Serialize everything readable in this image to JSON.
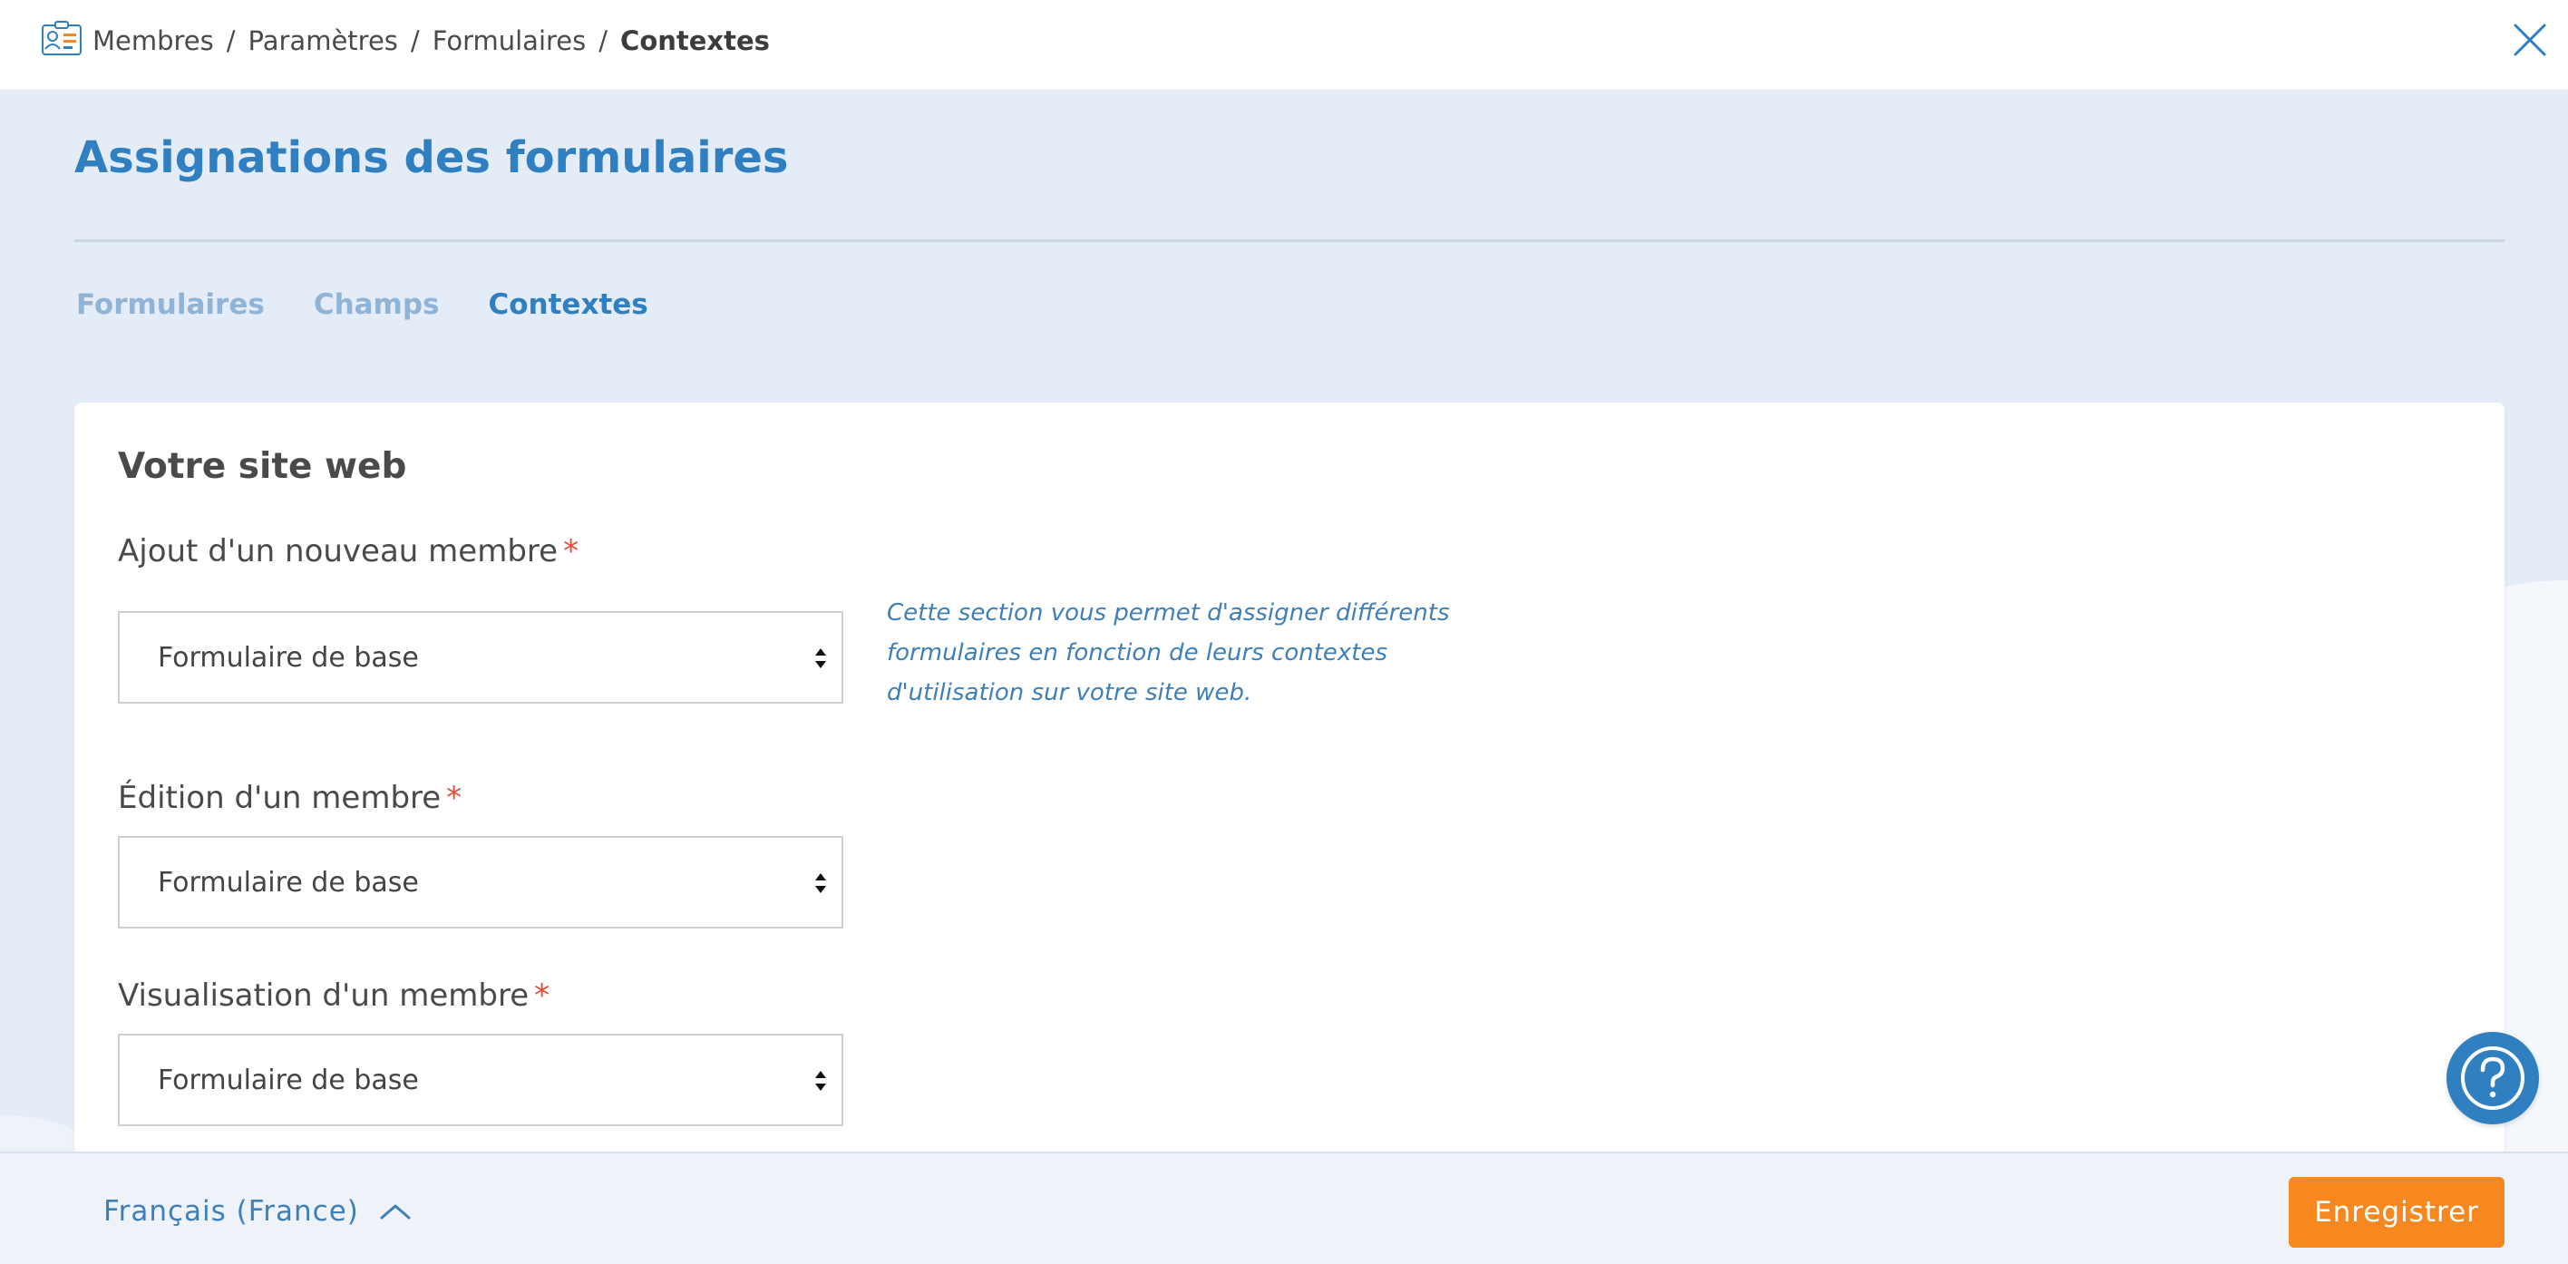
{
  "breadcrumb": {
    "items": [
      "Membres",
      "Paramètres",
      "Formulaires"
    ],
    "separator": "/",
    "current": "Contextes"
  },
  "page": {
    "title": "Assignations des formulaires"
  },
  "tabs": [
    {
      "label": "Formulaires",
      "active": false
    },
    {
      "label": "Champs",
      "active": false
    },
    {
      "label": "Contextes",
      "active": true
    }
  ],
  "card": {
    "title": "Votre site web",
    "required_marker": "*",
    "fields": [
      {
        "label": "Ajout d'un nouveau membre",
        "value": "Formulaire de base"
      },
      {
        "label": "Édition d'un membre",
        "value": "Formulaire de base"
      },
      {
        "label": "Visualisation d'un membre",
        "value": "Formulaire de base"
      }
    ],
    "help_text": "Cette section vous permet d'assigner différents formulaires en fonction de leurs contextes d'utilisation sur votre site web."
  },
  "footer": {
    "language": "Français (France)",
    "save_label": "Enregistrer"
  },
  "icons": {
    "app": "member-card-icon",
    "close": "close-icon",
    "help": "question-icon",
    "lang_toggle": "chevron-up-icon",
    "select_arrows": "sort-arrows-icon"
  },
  "colors": {
    "accent": "#2f7fc1",
    "tab_inactive": "#8fb4d8",
    "required": "#e04b3a",
    "save_button": "#f7871f",
    "page_background": "#e4ecf7"
  }
}
